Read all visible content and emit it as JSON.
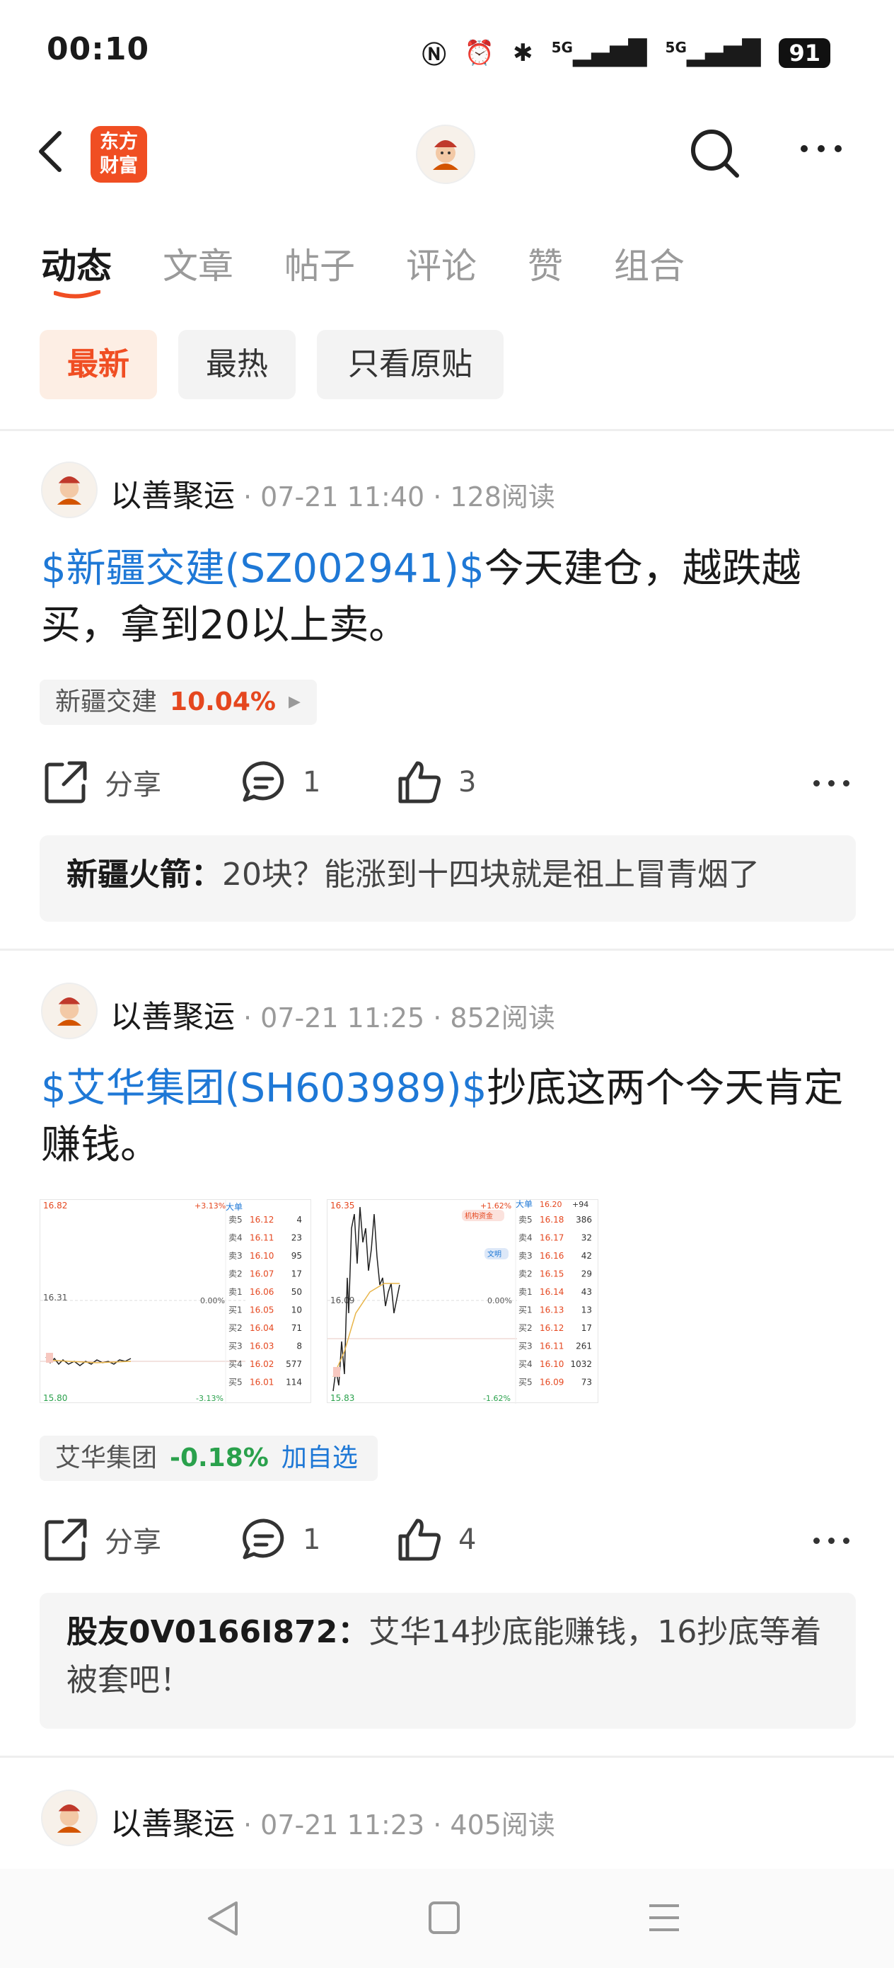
{
  "status_bar": {
    "time": "00:10",
    "signal1": "5G",
    "signal2": "5G",
    "battery": "91"
  },
  "header": {
    "logo_line1": "东方",
    "logo_line2": "财富"
  },
  "tabs": [
    {
      "label": "动态"
    },
    {
      "label": "文章"
    },
    {
      "label": "帖子"
    },
    {
      "label": "评论"
    },
    {
      "label": "赞"
    },
    {
      "label": "组合"
    }
  ],
  "filters": [
    {
      "label": "最新"
    },
    {
      "label": "最热"
    },
    {
      "label": "只看原贴"
    }
  ],
  "posts": [
    {
      "author": "以善聚运",
      "meta": "· 07-21 11:40 · 128阅读",
      "link": "$新疆交建(SZ002941)$",
      "text": "今天建仓，越跌越买，拿到20以上卖。",
      "stock_name": "新疆交建",
      "stock_change": "10.04%",
      "share_label": "分享",
      "comments": "1",
      "likes": "3",
      "comment_author": "新疆火箭：",
      "comment_text": "20块？能涨到十四块就是祖上冒青烟了"
    },
    {
      "author": "以善聚运",
      "meta": "· 07-21 11:25 · 852阅读",
      "link": "$艾华集团(SH603989)$",
      "text": "抄底这两个今天肯定赚钱。",
      "stock_name": "艾华集团",
      "stock_change": "-0.18%",
      "add_watch": "加自选",
      "share_label": "分享",
      "comments": "1",
      "likes": "4",
      "comment_author": "股友0V0166I872：",
      "comment_text": "艾华14抄底能赚钱，16抄底等着被套吧！",
      "chart1": {
        "top_left": "16.82",
        "mid_left": "16.31",
        "bottom_left": "15.80",
        "top_right": "+3.13%",
        "mid_right": "0.00%",
        "bottom_right": "-3.13%",
        "header": "大单",
        "asks": [
          [
            "卖5",
            "16.12",
            "4"
          ],
          [
            "卖4",
            "16.11",
            "23"
          ],
          [
            "卖3",
            "16.10",
            "95"
          ],
          [
            "卖2",
            "16.07",
            "17"
          ],
          [
            "卖1",
            "16.06",
            "50"
          ]
        ],
        "bids": [
          [
            "买1",
            "16.05",
            "10"
          ],
          [
            "买2",
            "16.04",
            "71"
          ],
          [
            "买3",
            "16.03",
            "8"
          ],
          [
            "买4",
            "16.02",
            "577"
          ],
          [
            "买5",
            "16.01",
            "114"
          ]
        ]
      },
      "chart2": {
        "top_left": "16.35",
        "mid_left": "16.09",
        "bottom_left": "15.83",
        "top_right": "+1.62%",
        "mid_right": "0.00%",
        "bottom_right": "-1.62%",
        "header": "大单",
        "header_val": "16.20",
        "header_vol": "+94",
        "badge1": "机构资金",
        "badge2": "文明",
        "asks": [
          [
            "卖5",
            "16.18",
            "386"
          ],
          [
            "卖4",
            "16.17",
            "32"
          ],
          [
            "卖3",
            "16.16",
            "42"
          ],
          [
            "卖2",
            "16.15",
            "29"
          ],
          [
            "卖1",
            "16.14",
            "43"
          ]
        ],
        "bids": [
          [
            "买1",
            "16.13",
            "13"
          ],
          [
            "买2",
            "16.12",
            "17"
          ],
          [
            "买3",
            "16.11",
            "261"
          ],
          [
            "买4",
            "16.10",
            "1032"
          ],
          [
            "买5",
            "16.09",
            "73"
          ]
        ]
      }
    },
    {
      "author": "以善聚运",
      "meta": "· 07-21 11:23 · 405阅读"
    }
  ]
}
